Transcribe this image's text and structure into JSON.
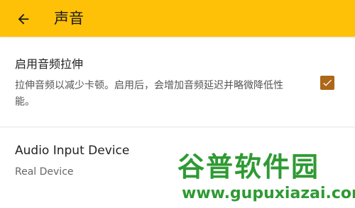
{
  "header": {
    "title": "声音",
    "back_icon": "arrow-left-icon",
    "background_color": "#ffc107"
  },
  "settings": [
    {
      "title": "启用音频拉伸",
      "description": "拉伸音频以减少卡顿。启用后，会增加音频延迟并略微降低性能。",
      "checked": true,
      "checkbox_color": "#ad6718"
    },
    {
      "title": "Audio Input Device",
      "value": "Real Device"
    }
  ],
  "watermark": {
    "title": "谷普软件园",
    "url": "www.gupuxiazai.com",
    "color": "#2f9a33"
  }
}
